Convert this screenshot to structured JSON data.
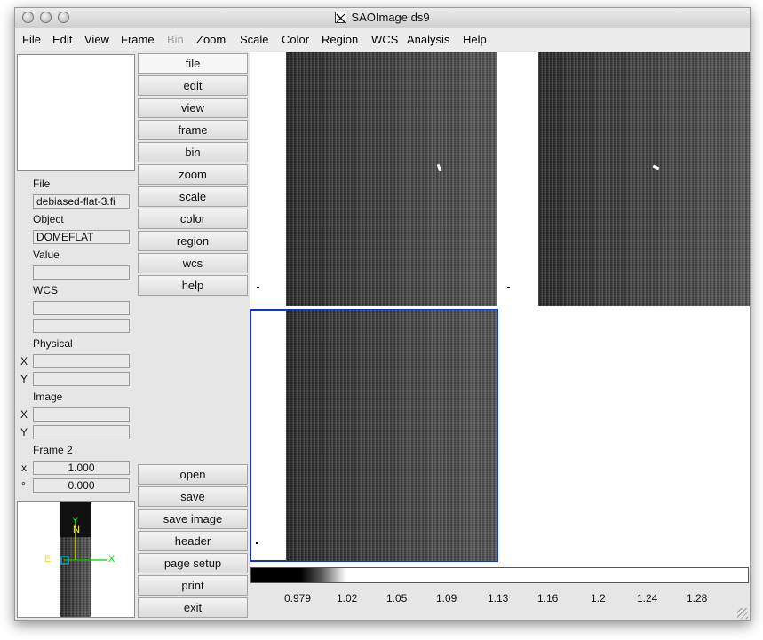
{
  "window": {
    "title": "SAOImage ds9"
  },
  "menu": [
    "File",
    "Edit",
    "View",
    "Frame",
    "Bin",
    "Zoom",
    "Scale",
    "Color",
    "Region",
    "WCS",
    "Analysis",
    "Help"
  ],
  "menu_disabled": [
    "Bin"
  ],
  "info": {
    "file_label": "File",
    "file_value": "debiased-flat-3.fi",
    "object_label": "Object",
    "object_value": "DOMEFLAT",
    "value_label": "Value",
    "wcs_label": "WCS",
    "physical_label": "Physical",
    "x_label": "X",
    "y_label": "Y",
    "image_label": "Image",
    "frame_label": "Frame 2",
    "zoom_symbol": "x",
    "zoom_value": "1.000",
    "angle_symbol": "°",
    "angle_value": "0.000"
  },
  "buttons_top": [
    "file",
    "edit",
    "view",
    "frame",
    "bin",
    "zoom",
    "scale",
    "color",
    "region",
    "wcs",
    "help"
  ],
  "buttons_bottom": [
    "open",
    "save",
    "save image",
    "header",
    "page setup",
    "print",
    "exit"
  ],
  "panner": {
    "north": "N",
    "east": "E",
    "x_axis": "X",
    "y_axis": "Y",
    "compass_color": "#00cc00",
    "axis_color": "#dddd00"
  },
  "colorbar": {
    "ticks": [
      "0.979",
      "1.02",
      "1.05",
      "1.09",
      "1.13",
      "1.16",
      "1.2",
      "1.24",
      "1.28"
    ]
  },
  "accent": {
    "current_frame": "#1133cc"
  }
}
